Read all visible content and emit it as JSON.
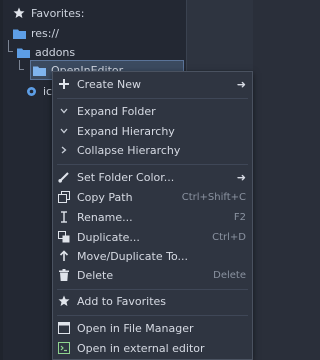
{
  "tree": {
    "favorites_label": "Favorites:",
    "res_label": "res://",
    "addons_label": "addons",
    "openineditor_label": "OpenInEditor",
    "icon_label": "ico"
  },
  "menu": {
    "items": [
      {
        "label": "Create New",
        "shortcut": "",
        "has_submenu": true
      },
      {
        "label": "Expand Folder",
        "shortcut": "",
        "has_submenu": false
      },
      {
        "label": "Expand Hierarchy",
        "shortcut": "",
        "has_submenu": false
      },
      {
        "label": "Collapse Hierarchy",
        "shortcut": "",
        "has_submenu": false
      },
      {
        "label": "Set Folder Color...",
        "shortcut": "",
        "has_submenu": true
      },
      {
        "label": "Copy Path",
        "shortcut": "Ctrl+Shift+C",
        "has_submenu": false
      },
      {
        "label": "Rename...",
        "shortcut": "F2",
        "has_submenu": false
      },
      {
        "label": "Duplicate...",
        "shortcut": "Ctrl+D",
        "has_submenu": false
      },
      {
        "label": "Move/Duplicate To...",
        "shortcut": "",
        "has_submenu": false
      },
      {
        "label": "Delete",
        "shortcut": "Delete",
        "has_submenu": false
      },
      {
        "label": "Add to Favorites",
        "shortcut": "",
        "has_submenu": false
      },
      {
        "label": "Open in File Manager",
        "shortcut": "",
        "has_submenu": false
      },
      {
        "label": "Open in external editor",
        "shortcut": "",
        "has_submenu": false
      }
    ],
    "submenu_arrow": "➜"
  },
  "colors": {
    "panel_bg": "#232833",
    "menu_bg": "#2f3541",
    "folder_blue": "#5d9ee6",
    "selection": "#3b4a5f"
  }
}
